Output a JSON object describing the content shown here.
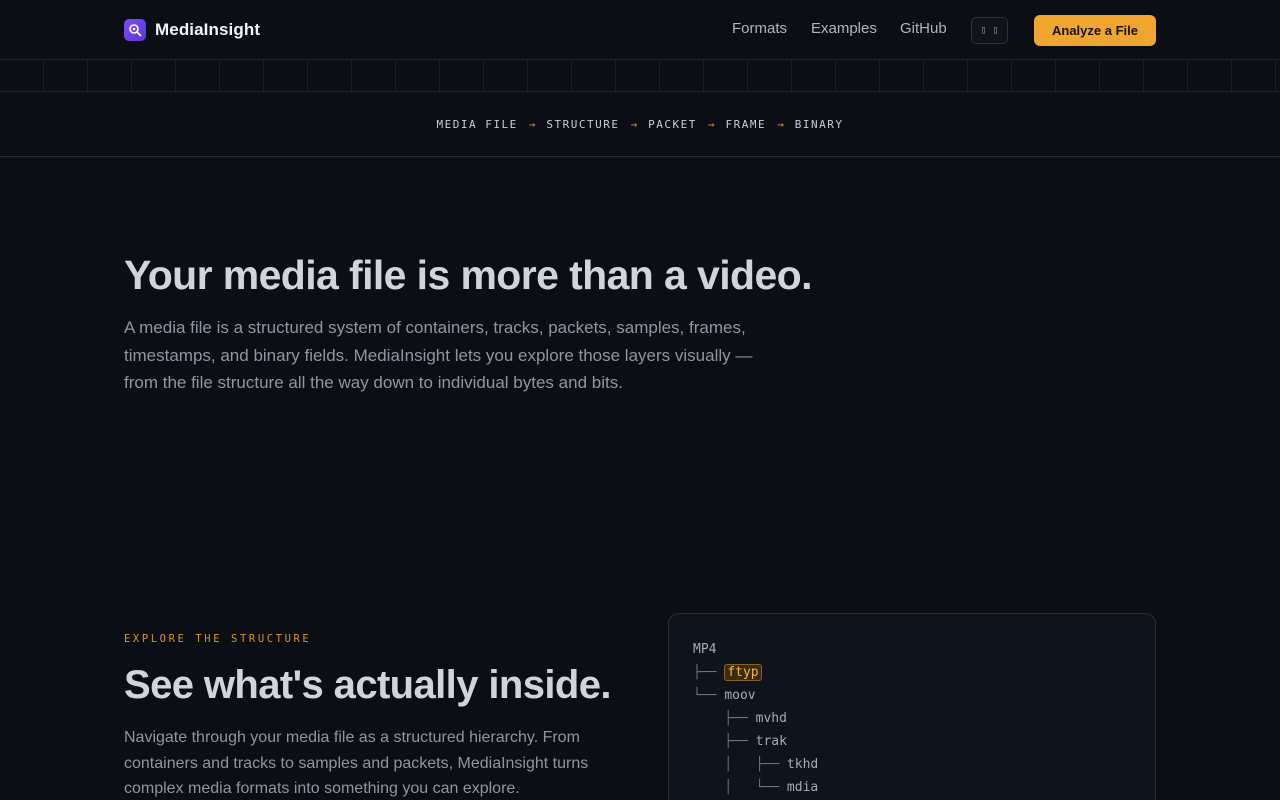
{
  "brand": {
    "name": "MediaInsight",
    "logo_icon": "magnifier-icon",
    "logo_color": "#6e44f0"
  },
  "nav": {
    "links": [
      {
        "label": "Formats"
      },
      {
        "label": "Examples"
      },
      {
        "label": "GitHub"
      }
    ],
    "theme_toggle_label": "▯ ▯",
    "cta_label": "Analyze a File"
  },
  "pipeline": {
    "steps": [
      "MEDIA FILE",
      "STRUCTURE",
      "PACKET",
      "FRAME",
      "BINARY"
    ],
    "arrow": "→"
  },
  "hero": {
    "title": "Your media file is more than a video.",
    "text": "A media file is a structured system of containers, tracks, packets, samples, frames, timestamps, and binary fields. MediaInsight lets you explore those layers visually — from the file structure all the way down to individual bytes and bits."
  },
  "explore": {
    "eyebrow": "EXPLORE THE STRUCTURE",
    "title": "See what's actually inside.",
    "text": "Navigate through your media file as a structured hierarchy. From containers and tracks to samples and packets, MediaInsight turns complex media formats into something you can explore."
  },
  "tree": {
    "lines": [
      {
        "prefix": "",
        "node": "MP4",
        "highlight": false
      },
      {
        "prefix": "├── ",
        "node": "ftyp",
        "highlight": true
      },
      {
        "prefix": "└── ",
        "node": "moov",
        "highlight": false
      },
      {
        "prefix": "    ├── ",
        "node": "mvhd",
        "highlight": false
      },
      {
        "prefix": "    ├── ",
        "node": "trak",
        "highlight": false
      },
      {
        "prefix": "    │   ├── ",
        "node": "tkhd",
        "highlight": false
      },
      {
        "prefix": "    │   └── ",
        "node": "mdia",
        "highlight": false
      }
    ]
  },
  "colors": {
    "background": "#0b0e14",
    "accent": "#f0a531",
    "brand": "#6e44f0"
  }
}
